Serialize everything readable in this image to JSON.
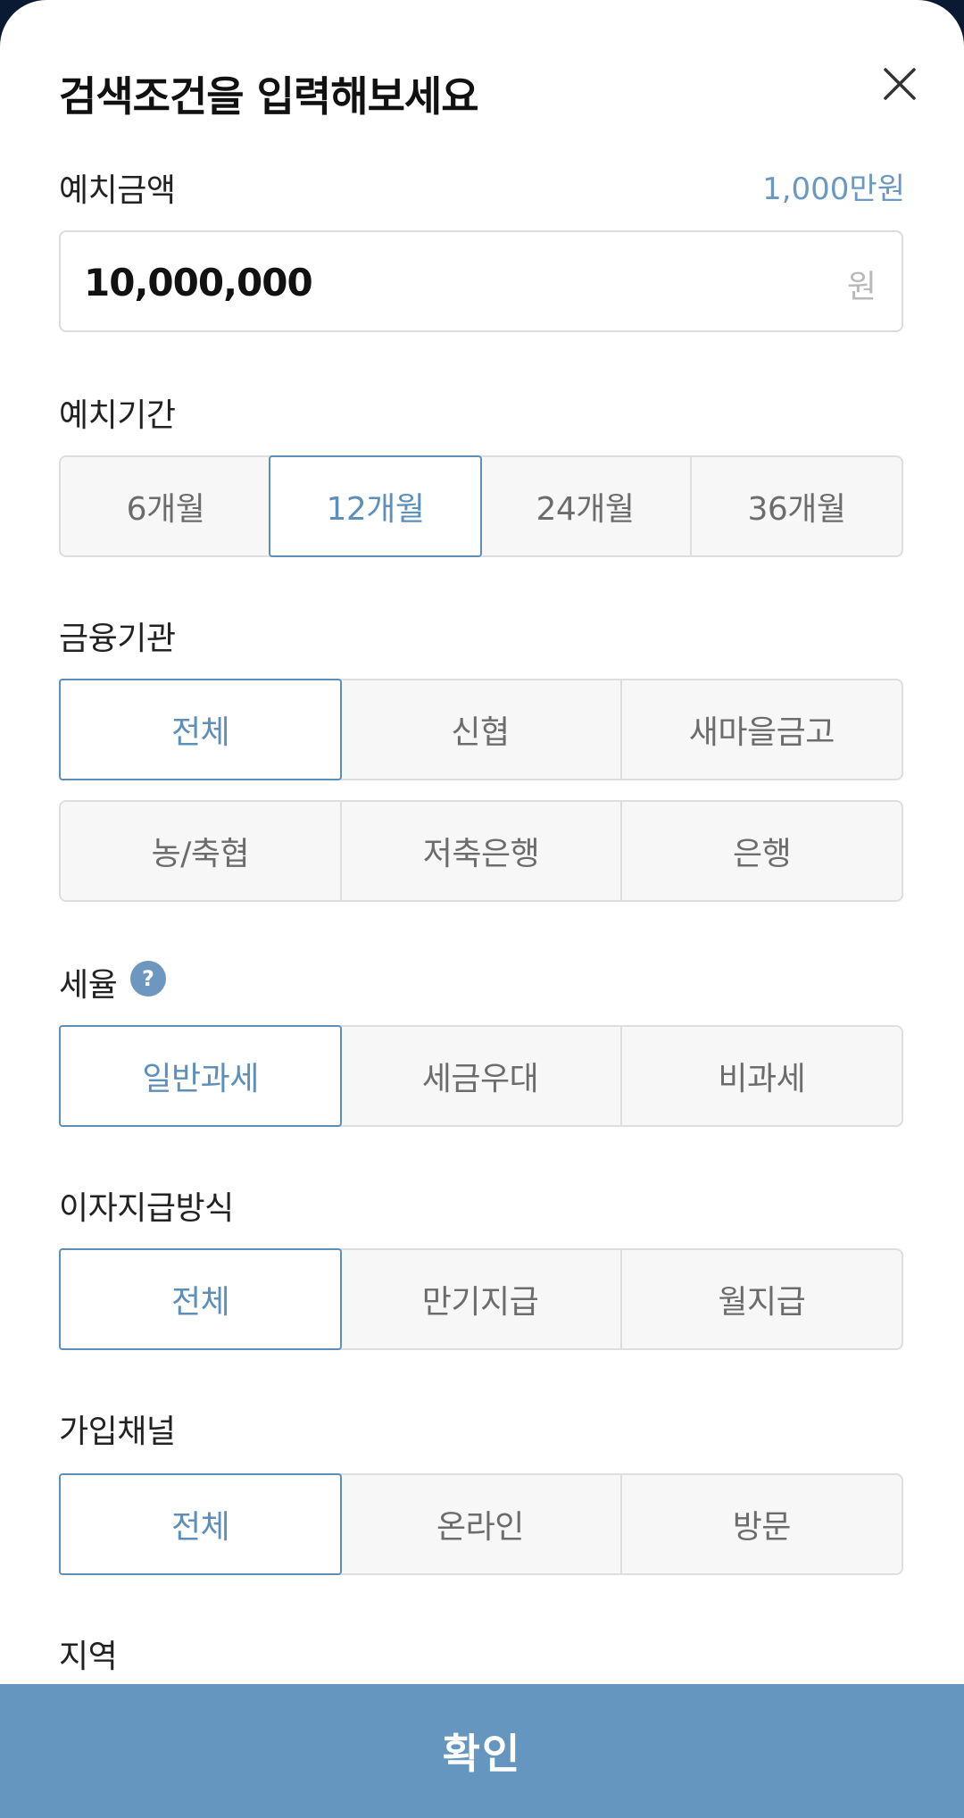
{
  "header": {
    "title": "검색조건을 입력해보세요"
  },
  "deposit_amount": {
    "label": "예치금액",
    "hint": "1,000만원",
    "value": "10,000,000",
    "unit": "원"
  },
  "period": {
    "label": "예치기간",
    "options": [
      "6개월",
      "12개월",
      "24개월",
      "36개월"
    ],
    "selected": "12개월"
  },
  "institution": {
    "label": "금융기관",
    "options_row1": [
      "전체",
      "신협",
      "새마을금고"
    ],
    "options_row2": [
      "농/축협",
      "저축은행",
      "은행"
    ],
    "selected": "전체"
  },
  "tax": {
    "label": "세율",
    "help_icon": "?",
    "options": [
      "일반과세",
      "세금우대",
      "비과세"
    ],
    "selected": "일반과세"
  },
  "interest_payment": {
    "label": "이자지급방식",
    "options": [
      "전체",
      "만기지급",
      "월지급"
    ],
    "selected": "전체"
  },
  "channel": {
    "label": "가입채널",
    "options": [
      "전체",
      "온라인",
      "방문"
    ],
    "selected": "전체"
  },
  "region": {
    "label": "지역"
  },
  "footer": {
    "confirm_label": "확인"
  },
  "colors": {
    "accent": "#5d8fbb",
    "confirm_bg": "#6596bf",
    "hint": "#6a98c0"
  },
  "icons": {
    "close": "close-icon",
    "help": "help-circle-icon"
  }
}
